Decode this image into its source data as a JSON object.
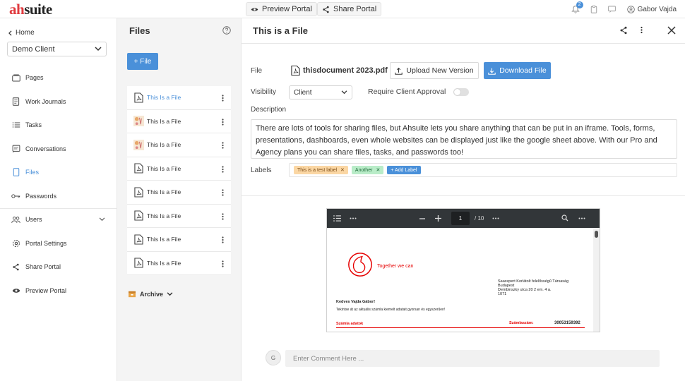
{
  "brand": {
    "logo_prefix": "ah",
    "logo_suffix": "suite"
  },
  "topbar": {
    "preview_portal": "Preview Portal",
    "share_portal": "Share Portal",
    "notification_count": "2",
    "user_name": "Gabor Vajda"
  },
  "sidebar": {
    "home": "Home",
    "client": "Demo Client",
    "items": [
      {
        "label": "Pages",
        "icon": "pages-icon"
      },
      {
        "label": "Work Journals",
        "icon": "journal-icon"
      },
      {
        "label": "Tasks",
        "icon": "tasks-icon"
      },
      {
        "label": "Conversations",
        "icon": "conversations-icon"
      },
      {
        "label": "Files",
        "icon": "files-icon",
        "active": true
      },
      {
        "label": "Passwords",
        "icon": "key-icon"
      },
      {
        "label": "Users",
        "icon": "users-icon"
      },
      {
        "label": "Portal Settings",
        "icon": "gear-icon"
      },
      {
        "label": "Share Portal",
        "icon": "share-icon"
      },
      {
        "label": "Preview Portal",
        "icon": "eye-icon"
      }
    ]
  },
  "files_panel": {
    "title": "Files",
    "add_button": "+ File",
    "files": [
      {
        "name": "This Is a File",
        "icon": "pdf-icon",
        "selected": true
      },
      {
        "name": "This Is a File",
        "icon": "image-thumbnail"
      },
      {
        "name": "This Is a File",
        "icon": "image-thumbnail"
      },
      {
        "name": "This Is a File",
        "icon": "pdf-icon"
      },
      {
        "name": "This Is a File",
        "icon": "pdf-icon"
      },
      {
        "name": "This Is a File",
        "icon": "pdf-icon"
      },
      {
        "name": "This Is a File",
        "icon": "pdf-icon"
      },
      {
        "name": "This Is a File",
        "icon": "pdf-icon"
      }
    ],
    "archive": "Archive"
  },
  "main": {
    "title": "This is a File",
    "file_label": "File",
    "file_name": "thisdocument 2023.pdf",
    "upload_button": "Upload New Version",
    "download_button": "Download File",
    "visibility_label": "Visibility",
    "visibility_value": "Client",
    "approval_label": "Require Client Approval",
    "approval_enabled": false,
    "description_label": "Description",
    "description": "There are lots of tools for sharing files, but Ahsuite lets you share anything that can be put in an iframe. Tools, forms, presentations, dashboards, even whole websites can be displayed just like the google sheet above. With our Pro and Agency plans you can share files, tasks, and passwords too!",
    "labels_label": "Labels",
    "labels": [
      {
        "text": "This is a test label",
        "color": "#fbd7a4"
      },
      {
        "text": "Another",
        "color": "#b9ecc8"
      }
    ],
    "add_label": "+ Add Label"
  },
  "pdf_viewer": {
    "page_current": "1",
    "page_total": "/ 10",
    "brand_tagline": "Together we can",
    "address": [
      "Saasxpert Korlátolt felelősségű Társaság",
      "Budapest",
      "Dembinszky utca 20 2 em. 4 a.",
      "1071"
    ],
    "salutation": "Kedves Vajda Gábor!",
    "body": "Tekintse át az aktuális számla kiemelt adatait gyorsan és egyszerűen!",
    "section_label": "Számla adatok",
    "invoice_label": "Számlaszám:",
    "invoice_number": "30053159392"
  },
  "comments": {
    "avatar_initial": "G",
    "placeholder": "Enter Comment Here ..."
  },
  "colors": {
    "accent": "#4a90d9",
    "brand_red": "#e03a3e"
  }
}
